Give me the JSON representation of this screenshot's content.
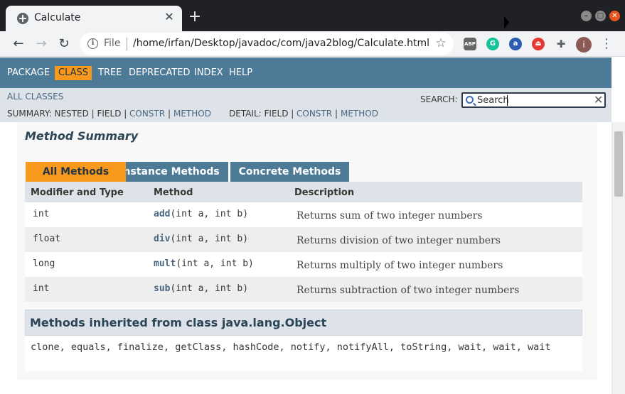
{
  "browser": {
    "tab_title": "Calculate",
    "tab_close": "✕",
    "new_tab": "+",
    "scheme": "File",
    "url": "/home/irfan/Desktop/javadoc/com/java2blog/Calculate.html",
    "nav_back": "←",
    "nav_forward": "→",
    "nav_reload": "↻",
    "star": "☆",
    "menu": "⋮",
    "extensions": [
      "ABP",
      "G",
      "a",
      "⏏",
      "✚"
    ],
    "profile_initial": "i",
    "window_buttons": [
      "–",
      "□",
      "✕"
    ]
  },
  "topnav": {
    "items": [
      "PACKAGE",
      "CLASS",
      "TREE",
      "DEPRECATED",
      "INDEX",
      "HELP"
    ]
  },
  "subnav": {
    "all_classes": "ALL CLASSES",
    "search_label": "SEARCH:",
    "search_placeholder": "Search",
    "search_reset": "✕",
    "summary_label": "SUMMARY: NESTED | FIELD |",
    "summary_constr": "CONSTR",
    "sep": "|",
    "summary_method": "METHOD",
    "detail_label": "DETAIL: FIELD |",
    "detail_constr": "CONSTR",
    "detail_method": "METHOD"
  },
  "method_summary": {
    "title": "Method Summary",
    "tabs": [
      "All Methods",
      "Instance Methods",
      "Concrete Methods"
    ],
    "headers": [
      "Modifier and Type",
      "Method",
      "Description"
    ],
    "rows": [
      {
        "type": "int",
        "name": "add",
        "params": "(int a, int b)",
        "desc": "Returns sum of two integer numbers"
      },
      {
        "type": "float",
        "name": "div",
        "params": "(int a, int b)",
        "desc": "Returns division of two integer numbers"
      },
      {
        "type": "long",
        "name": "mult",
        "params": "(int a, int b)",
        "desc": "Returns multiply of two integer numbers"
      },
      {
        "type": "int",
        "name": "sub",
        "params": "(int a, int b)",
        "desc": "Returns subtraction of two integer numbers"
      }
    ]
  },
  "inherited": {
    "title": "Methods inherited from class java.lang.Object",
    "list": "clone, equals, finalize, getClass, hashCode, notify, notifyAll, toString, wait, wait, wait"
  },
  "colors": {
    "nav_blue": "#4d7a97",
    "nav_orange": "#f8981d",
    "subnav_gray": "#dee3e9",
    "link_blue": "#4a6782"
  }
}
